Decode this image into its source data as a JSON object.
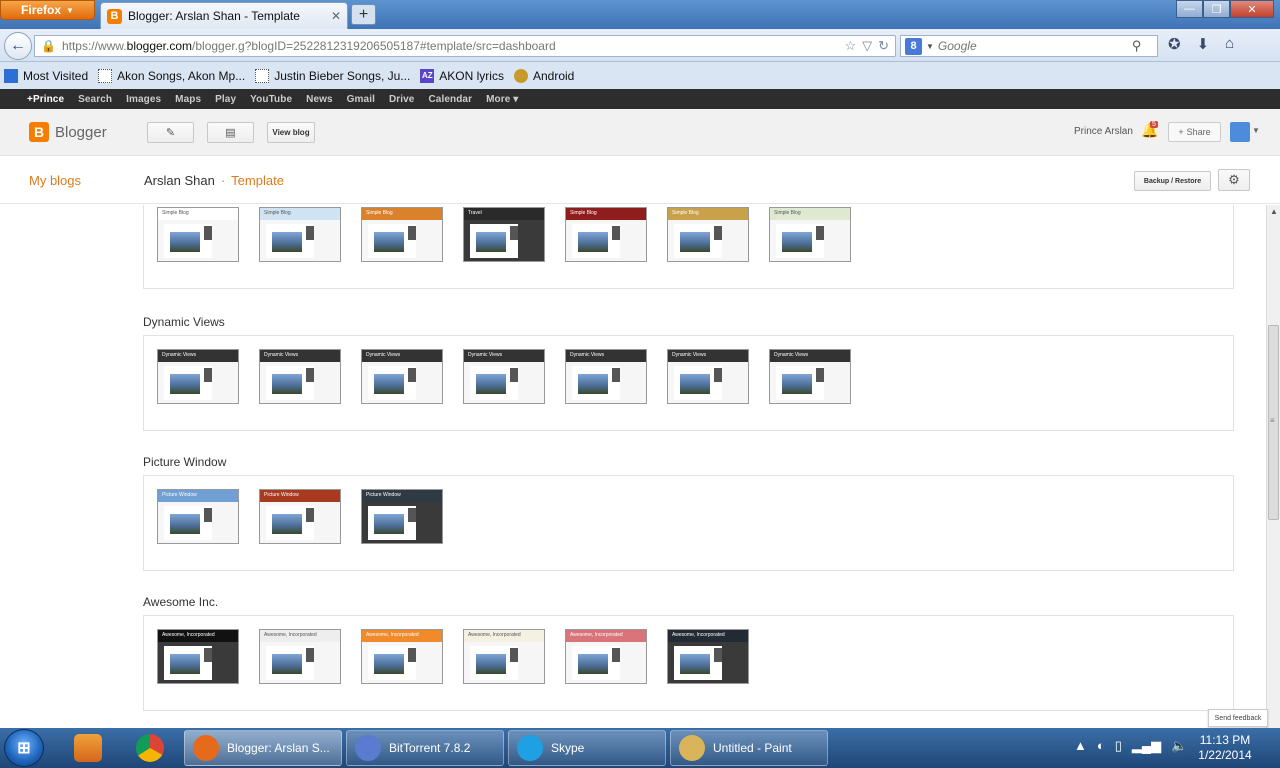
{
  "browser": {
    "app_menu_label": "Firefox",
    "tab_title": "Blogger: Arslan Shan - Template",
    "url_prefix": "https://www.",
    "url_host": "blogger.com",
    "url_path": "/blogger.g?blogID=2522812319206505187#template/src=dashboard",
    "search_placeholder": "Google",
    "bookmarks": [
      {
        "label": "Most Visited"
      },
      {
        "label": "Akon Songs, Akon Mp..."
      },
      {
        "label": "Justin Bieber Songs, Ju..."
      },
      {
        "label": "AKON lyrics",
        "icon_text": "AZ"
      },
      {
        "label": "Android"
      }
    ]
  },
  "google_bar": [
    "+Prince",
    "Search",
    "Images",
    "Maps",
    "Play",
    "YouTube",
    "News",
    "Gmail",
    "Drive",
    "Calendar",
    "More ▾"
  ],
  "blogger": {
    "logo_text": "Blogger",
    "view_blog_label": "View blog",
    "user_name": "Prince Arslan",
    "notification_count": "5",
    "share_label": "Share",
    "my_blogs_label": "My blogs",
    "blog_name": "Arslan Shan",
    "crumb_separator": "·",
    "current_page": "Template",
    "backup_label": "Backup / Restore"
  },
  "sections": [
    {
      "title": "",
      "thumbs": [
        {
          "header_color": "#ffffff",
          "title_text": "Simple Blog"
        },
        {
          "header_color": "#cfe3f3",
          "title_text": "Simple Blog"
        },
        {
          "header_color": "#d9822b",
          "title_text": "Simple Blog"
        },
        {
          "header_color": "#2a2a2a",
          "title_text": "Travel"
        },
        {
          "header_color": "#8f1d1d",
          "title_text": "Simple Blog"
        },
        {
          "header_color": "#c9a14a",
          "title_text": "Simple Blog"
        },
        {
          "header_color": "#dfe9d2",
          "title_text": "Simple Blog"
        }
      ]
    },
    {
      "title": "Dynamic Views",
      "thumbs": [
        {
          "header_color": "#333333",
          "title_text": "Dynamic Views"
        },
        {
          "header_color": "#333333",
          "title_text": "Dynamic Views"
        },
        {
          "header_color": "#333333",
          "title_text": "Dynamic Views"
        },
        {
          "header_color": "#333333",
          "title_text": "Dynamic Views"
        },
        {
          "header_color": "#333333",
          "title_text": "Dynamic Views"
        },
        {
          "header_color": "#333333",
          "title_text": "Dynamic Views"
        },
        {
          "header_color": "#333333",
          "title_text": "Dynamic Views"
        }
      ]
    },
    {
      "title": "Picture Window",
      "thumbs": [
        {
          "header_color": "#6f9fd4",
          "title_text": "Picture Window"
        },
        {
          "header_color": "#a63b20",
          "title_text": "Picture Window"
        },
        {
          "header_color": "#2f3a44",
          "title_text": "Picture Window"
        }
      ]
    },
    {
      "title": "Awesome Inc.",
      "thumbs": [
        {
          "header_color": "#111111",
          "title_text": "Awesome, Incorporated"
        },
        {
          "header_color": "#eeeeee",
          "title_text": "Awesome, Incorporated"
        },
        {
          "header_color": "#f08a2a",
          "title_text": "Awesome, Incorporated"
        },
        {
          "header_color": "#f3f1e2",
          "title_text": "Awesome, Incorporated"
        },
        {
          "header_color": "#d9747a",
          "title_text": "Awesome, Incorporated"
        },
        {
          "header_color": "#222a33",
          "title_text": "Awesome, Incorporated"
        }
      ]
    }
  ],
  "feedback_label": "Send feedback",
  "taskbar": {
    "tasks": [
      {
        "label": "Blogger: Arslan S...",
        "icon_color": "#e66a1c"
      },
      {
        "label": "BitTorrent 7.8.2",
        "icon_color": "#5a7bd0"
      },
      {
        "label": "Skype",
        "icon_color": "#1fa0e3"
      },
      {
        "label": "Untitled - Paint",
        "icon_color": "#d9b45a"
      }
    ],
    "time": "11:13 PM",
    "date": "1/22/2014"
  }
}
